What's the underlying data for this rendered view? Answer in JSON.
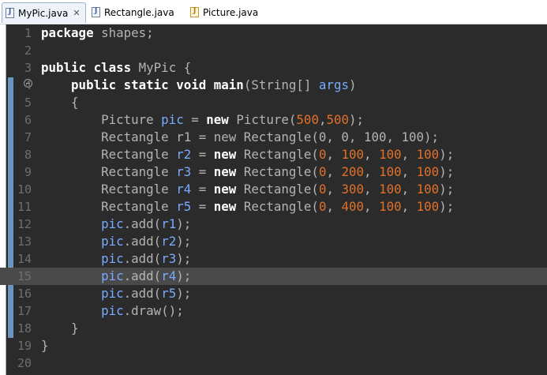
{
  "tabs": [
    {
      "label": "MyPic.java",
      "icon": "java-file-icon",
      "active": true,
      "close": "✕"
    },
    {
      "label": "Rectangle.java",
      "icon": "java-file-icon",
      "active": false
    },
    {
      "label": "Picture.java",
      "icon": "java-file-warning-icon",
      "active": false
    }
  ],
  "editor": {
    "current_line": 15,
    "lines": [
      {
        "n": "1",
        "code": [
          [
            "kw",
            "package"
          ],
          [
            "cls",
            " shapes;"
          ]
        ]
      },
      {
        "n": "2",
        "code": []
      },
      {
        "n": "3",
        "code": [
          [
            "kw",
            "public class"
          ],
          [
            "cls",
            " MyPic {"
          ]
        ]
      },
      {
        "n": "4",
        "code": [
          [
            "cls",
            "    "
          ],
          [
            "kw",
            "public static void"
          ],
          [
            "cls",
            " "
          ],
          [
            "meth",
            "main"
          ],
          [
            "cls",
            "(String[] "
          ],
          [
            "fld",
            "args"
          ],
          [
            "cls",
            ")"
          ]
        ]
      },
      {
        "n": "5",
        "code": [
          [
            "cls",
            "    {"
          ]
        ]
      },
      {
        "n": "6",
        "code": [
          [
            "cls",
            "        Picture "
          ],
          [
            "fld",
            "pic"
          ],
          [
            "cls",
            " = "
          ],
          [
            "kw",
            "new"
          ],
          [
            "cls",
            " Picture("
          ],
          [
            "num",
            "500"
          ],
          [
            "cls",
            ","
          ],
          [
            "num",
            "500"
          ],
          [
            "cls",
            ");"
          ]
        ]
      },
      {
        "n": "7",
        "code": [
          [
            "cls",
            "        Rectangle r1 = new Rectangle(0, 0, 100, 100);"
          ]
        ]
      },
      {
        "n": "8",
        "code": [
          [
            "cls",
            "        Rectangle "
          ],
          [
            "fld",
            "r2"
          ],
          [
            "cls",
            " = "
          ],
          [
            "kw",
            "new"
          ],
          [
            "cls",
            " Rectangle("
          ],
          [
            "num",
            "0"
          ],
          [
            "cls",
            ", "
          ],
          [
            "num",
            "100"
          ],
          [
            "cls",
            ", "
          ],
          [
            "num",
            "100"
          ],
          [
            "cls",
            ", "
          ],
          [
            "num",
            "100"
          ],
          [
            "cls",
            ");"
          ]
        ]
      },
      {
        "n": "9",
        "code": [
          [
            "cls",
            "        Rectangle "
          ],
          [
            "fld",
            "r3"
          ],
          [
            "cls",
            " = "
          ],
          [
            "kw",
            "new"
          ],
          [
            "cls",
            " Rectangle("
          ],
          [
            "num",
            "0"
          ],
          [
            "cls",
            ", "
          ],
          [
            "num",
            "200"
          ],
          [
            "cls",
            ", "
          ],
          [
            "num",
            "100"
          ],
          [
            "cls",
            ", "
          ],
          [
            "num",
            "100"
          ],
          [
            "cls",
            ");"
          ]
        ]
      },
      {
        "n": "10",
        "code": [
          [
            "cls",
            "        Rectangle "
          ],
          [
            "fld",
            "r4"
          ],
          [
            "cls",
            " = "
          ],
          [
            "kw",
            "new"
          ],
          [
            "cls",
            " Rectangle("
          ],
          [
            "num",
            "0"
          ],
          [
            "cls",
            ", "
          ],
          [
            "num",
            "300"
          ],
          [
            "cls",
            ", "
          ],
          [
            "num",
            "100"
          ],
          [
            "cls",
            ", "
          ],
          [
            "num",
            "100"
          ],
          [
            "cls",
            ");"
          ]
        ]
      },
      {
        "n": "11",
        "code": [
          [
            "cls",
            "        Rectangle "
          ],
          [
            "fld",
            "r5"
          ],
          [
            "cls",
            " = "
          ],
          [
            "kw",
            "new"
          ],
          [
            "cls",
            " Rectangle("
          ],
          [
            "num",
            "0"
          ],
          [
            "cls",
            ", "
          ],
          [
            "num",
            "400"
          ],
          [
            "cls",
            ", "
          ],
          [
            "num",
            "100"
          ],
          [
            "cls",
            ", "
          ],
          [
            "num",
            "100"
          ],
          [
            "cls",
            ");"
          ]
        ]
      },
      {
        "n": "12",
        "code": [
          [
            "cls",
            "        "
          ],
          [
            "fld",
            "pic"
          ],
          [
            "cls",
            ".add("
          ],
          [
            "fld",
            "r1"
          ],
          [
            "cls",
            ");"
          ]
        ]
      },
      {
        "n": "13",
        "code": [
          [
            "cls",
            "        "
          ],
          [
            "fld",
            "pic"
          ],
          [
            "cls",
            ".add("
          ],
          [
            "fld",
            "r2"
          ],
          [
            "cls",
            ");"
          ]
        ]
      },
      {
        "n": "14",
        "code": [
          [
            "cls",
            "        "
          ],
          [
            "fld",
            "pic"
          ],
          [
            "cls",
            ".add("
          ],
          [
            "fld",
            "r3"
          ],
          [
            "cls",
            ");"
          ]
        ]
      },
      {
        "n": "15",
        "code": [
          [
            "cls",
            "        "
          ],
          [
            "fld",
            "pic"
          ],
          [
            "cls",
            ".add("
          ],
          [
            "fld",
            "r4"
          ],
          [
            "cls",
            ");"
          ]
        ]
      },
      {
        "n": "16",
        "code": [
          [
            "cls",
            "        "
          ],
          [
            "fld",
            "pic"
          ],
          [
            "cls",
            ".add("
          ],
          [
            "fld",
            "r5"
          ],
          [
            "cls",
            ");"
          ]
        ]
      },
      {
        "n": "17",
        "code": [
          [
            "cls",
            "        "
          ],
          [
            "fld",
            "pic"
          ],
          [
            "cls",
            ".draw();"
          ]
        ]
      },
      {
        "n": "18",
        "code": [
          [
            "cls",
            "    }"
          ]
        ]
      },
      {
        "n": "19",
        "code": [
          [
            "cls",
            "}"
          ]
        ]
      },
      {
        "n": "20",
        "code": []
      }
    ]
  },
  "colors": {
    "background": "#2b2b2b",
    "keyword": "#ffffff",
    "field": "#79abff",
    "number": "#e0712a",
    "current_line": "#4a4a4a"
  }
}
